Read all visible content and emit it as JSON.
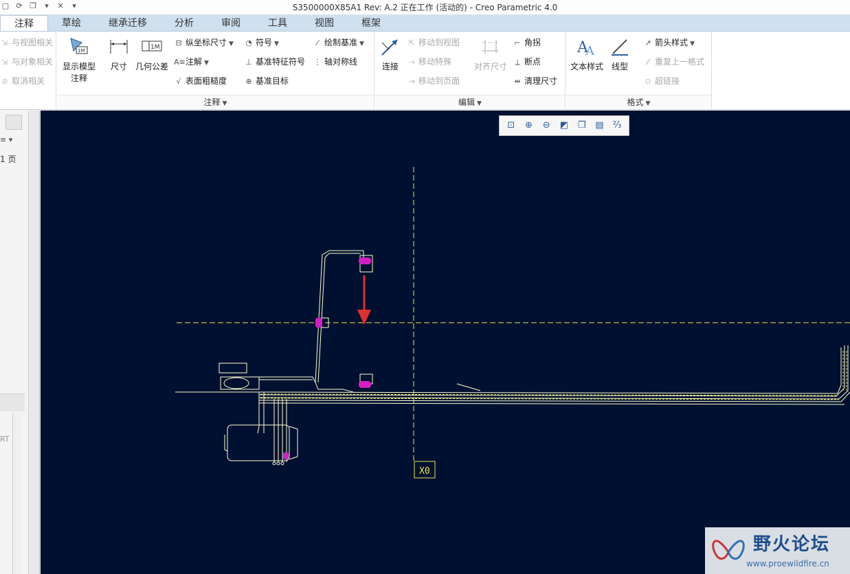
{
  "window": {
    "title": "S3500000X85A1 Rev: A.2 正在工作 (活动的) - Creo Parametric 4.0"
  },
  "tabs": [
    {
      "label": "注释",
      "active": true
    },
    {
      "label": "草绘"
    },
    {
      "label": "继承迁移"
    },
    {
      "label": "分析"
    },
    {
      "label": "审阅"
    },
    {
      "label": "工具"
    },
    {
      "label": "视图"
    },
    {
      "label": "框架"
    }
  ],
  "ribbon": {
    "left_items": [
      "与视图相关",
      "与对象相关",
      "取消相关"
    ],
    "annotate": {
      "group_label": "注释",
      "show_model": "显示模型\n注释",
      "dimension": "尺寸",
      "gtol": "几何公差",
      "ordinate": "纵坐标尺寸",
      "note": "注解",
      "surface_finish": "表面粗糙度",
      "symbol": "符号",
      "datum_feature": "基准特征符号",
      "datum_target": "基准目标",
      "draw_datum": "绘制基准",
      "axis_sym": "轴对称线"
    },
    "edit": {
      "group_label": "编辑",
      "connect": "连接",
      "move_to_view": "移动到视图",
      "move_special": "移动特殊",
      "move_to_page": "移动到页面",
      "align_dim": "对齐尺寸",
      "corner": "角拐",
      "breakpoint": "断点",
      "cleanup_dim": "清理尺寸"
    },
    "format": {
      "group_label": "格式",
      "text_style": "文本样式",
      "line_style": "线型",
      "arrow_style": "箭头样式",
      "repeat_format": "重复上一格式",
      "hyperlink": "超链接"
    }
  },
  "left_panel": {
    "page_label": "1 页",
    "tree_label": "RT"
  },
  "canvas": {
    "axis_label": "X0",
    "background": "#001030",
    "line_color": "#ffffd0",
    "dash_color": "#e8e84a",
    "arrow_color": "#e23030"
  },
  "watermark": {
    "name": "野火论坛",
    "url": "www.proewildfire.cn"
  }
}
